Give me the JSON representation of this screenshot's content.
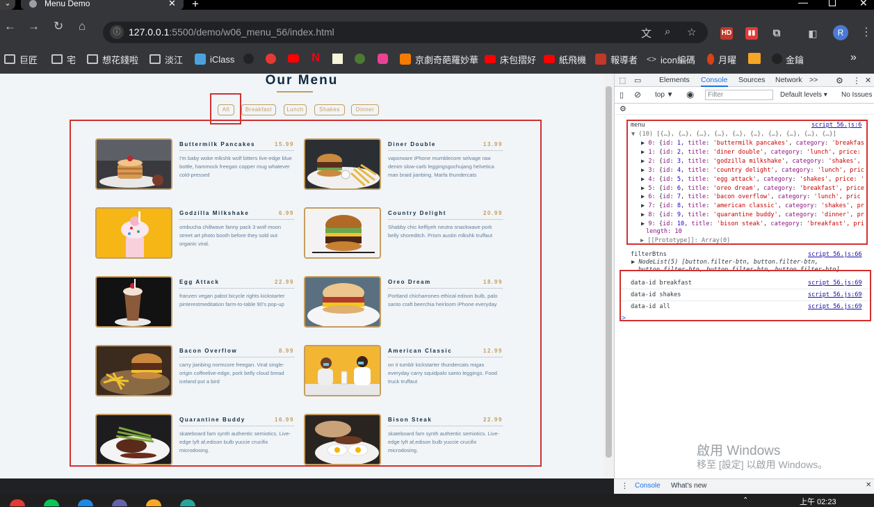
{
  "browser": {
    "tab_title": "Menu Demo",
    "tab_close": "✕",
    "new_tab": "+",
    "url_host": "127.0.0.1",
    "url_rest": ":5500/demo/w06_menu_56/index.html",
    "profile_initial": "R",
    "bookmarks": [
      {
        "label": "巨匠",
        "icon": "folder-icon"
      },
      {
        "label": "宅",
        "icon": "folder-icon"
      },
      {
        "label": "想花錢啦",
        "icon": "folder-icon"
      },
      {
        "label": "淡江",
        "icon": "folder-icon"
      },
      {
        "label": "iClass",
        "icon": "iclass-icon"
      },
      {
        "label": "京劇奇葩羅妙華",
        "icon": "blogger-icon"
      },
      {
        "label": "床包摺好",
        "icon": "youtube-icon"
      },
      {
        "label": "紙飛機",
        "icon": "youtube-icon"
      },
      {
        "label": "報導者",
        "icon": "news-icon"
      },
      {
        "label": "icon編碼",
        "icon": "code-icon"
      },
      {
        "label": "月曜",
        "icon": "moon-icon"
      },
      {
        "label": "金鑰",
        "icon": "key-icon"
      }
    ],
    "more_bookmarks": "»"
  },
  "page": {
    "title": "Our Menu",
    "filters": [
      "All",
      "Breakfast",
      "Lunch",
      "Shakes",
      "Dinner"
    ],
    "items": [
      {
        "title": "Buttermilk Pancakes",
        "price": "15.99",
        "desc": "I'm baby woke mlkshk wolf bitters live-edge blue bottle, hammock freegan copper mug whatever cold-pressed"
      },
      {
        "title": "Diner Double",
        "price": "13.99",
        "desc": "vaporware iPhone mumblecore selvage raw denim slow-carb leggingsgochujang helvetica man braid jianbing. Marfa thundercats"
      },
      {
        "title": "Godzilla Milkshake",
        "price": "6.99",
        "desc": "ombucha chillwave fanny pack 3 wolf moon street art photo booth before they sold out organic viral."
      },
      {
        "title": "Country Delight",
        "price": "20.99",
        "desc": "Shabby chic keffiyeh neutra snackwave pork belly shoreditch. Prism austin mlkshk truffaut"
      },
      {
        "title": "Egg Attack",
        "price": "22.99",
        "desc": "franzen vegan pabst bicycle rights kickstarter pinterestmeditation farm-to-table 90's pop-up"
      },
      {
        "title": "Oreo Dream",
        "price": "18.99",
        "desc": "Portland chicharrones ethical edison bulb, palo santo craft beerchia heirloom iPhone everyday"
      },
      {
        "title": "Bacon Overflow",
        "price": "8.99",
        "desc": "carry jianbing normcore freegan. Viral single-origin coffeelive-edge, pork belly cloud bread iceland put a bird"
      },
      {
        "title": "American Classic",
        "price": "12.99",
        "desc": "on it tumblr kickstarter thundercats migas everyday carry squidpalo santo leggings. Food truck truffaut"
      },
      {
        "title": "Quarantine Buddy",
        "price": "16.99",
        "desc": "skateboard fam synth authentic semiotics. Live-edge lyft af,edison bulb yuccie crucifix microdosing."
      },
      {
        "title": "Bison Steak",
        "price": "22.99",
        "desc": "skateboard fam synth authentic semiotics. Live-edge lyft af,edison bulb yuccie crucifix microdosing."
      }
    ]
  },
  "devtools": {
    "tabs": [
      "Elements",
      "Console",
      "Sources",
      "Network",
      ">>"
    ],
    "context": "top ▼",
    "filter_placeholder": "Filter",
    "levels": "Default levels ▾",
    "issues": "No Issues",
    "log_menu_label": "menu",
    "log_menu_src": "script_56.js:6",
    "menu_summary": "▼ (10) [{…}, {…}, {…}, {…}, {…}, {…}, {…}, {…}, {…}, {…}]",
    "menu_rows": [
      {
        "idx": "0",
        "id": "1",
        "title": "'buttermilk pancakes'",
        "cat": "'breakfas"
      },
      {
        "idx": "1",
        "id": "2",
        "title": "'diner double'",
        "cat": "'lunch', price:"
      },
      {
        "idx": "2",
        "id": "3",
        "title": "'godzilla milkshake'",
        "cat": "'shakes',"
      },
      {
        "idx": "3",
        "id": "4",
        "title": "'country delight'",
        "cat": "'lunch', pric"
      },
      {
        "idx": "4",
        "id": "5",
        "title": "'egg attack'",
        "cat": "'shakes', price: '"
      },
      {
        "idx": "5",
        "id": "6",
        "title": "'oreo dream'",
        "cat": "'breakfast', price"
      },
      {
        "idx": "6",
        "id": "7",
        "title": "'bacon overflow'",
        "cat": "'lunch', pric"
      },
      {
        "idx": "7",
        "id": "8",
        "title": "'american classic'",
        "cat": "'shakes', pr"
      },
      {
        "idx": "8",
        "id": "9",
        "title": "'quarantine buddy'",
        "cat": "'dinner', pr"
      },
      {
        "idx": "9",
        "id": "10",
        "title": "'bison steak'",
        "cat": "'breakfast', pri"
      }
    ],
    "menu_length": "length: 10",
    "menu_proto": "▶ [[Prototype]]: Array(0)",
    "log_btns_label": "filterBtns",
    "log_btns_src": "script_56.js:66",
    "btns_line1": "▶ NodeList(5) [button.filter-btn, button.filter-btn,",
    "btns_line2": "button.filter-btn, button.filter-btn, button.filter-btn]",
    "data_logs": [
      {
        "text": "data-id breakfast",
        "src": "script_56.js:69"
      },
      {
        "text": "data-id shakes",
        "src": "script_56.js:69"
      },
      {
        "text": "data-id all",
        "src": "script_56.js:69"
      }
    ],
    "prompt": ">",
    "drawer_tabs": [
      "Console",
      "What's new"
    ]
  },
  "windows": {
    "watermark_line1": "啟用 Windows",
    "watermark_line2": "移至 [設定] 以啟用 Windows。",
    "clock": "上午 02:23"
  }
}
